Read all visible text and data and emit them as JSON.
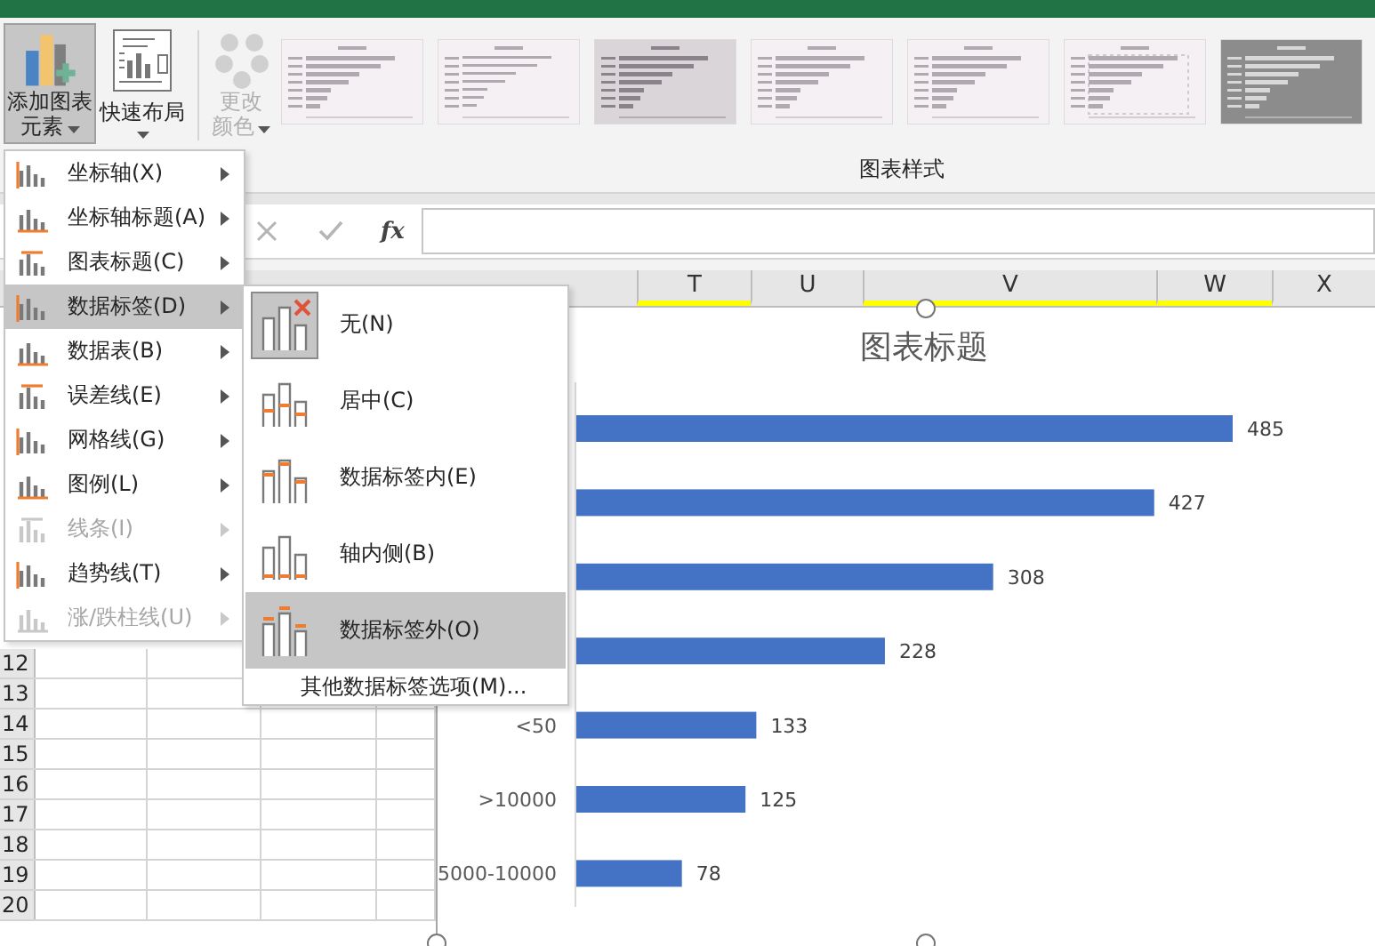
{
  "ribbon": {
    "buttons": [
      {
        "kind": "elements",
        "lines": [
          "添加图表",
          "元素"
        ],
        "selected": true,
        "disabled": false
      },
      {
        "kind": "layout",
        "lines": [
          "快速布局"
        ],
        "selected": false,
        "disabled": false
      },
      {
        "kind": "colors",
        "lines": [
          "更改",
          "颜色"
        ],
        "selected": false,
        "disabled": true
      }
    ],
    "styles": [
      {
        "kind": "plain"
      },
      {
        "kind": "dotted"
      },
      {
        "kind": "shaded"
      },
      {
        "kind": "plain"
      },
      {
        "kind": "plain"
      },
      {
        "kind": "hatched"
      },
      {
        "kind": "dark"
      }
    ],
    "group_label": "图表样式"
  },
  "formula_bar": {
    "fx": "fx"
  },
  "columns": [
    {
      "label": "T",
      "highlighted": true
    },
    {
      "label": "U",
      "highlighted": false
    },
    {
      "label": "V",
      "highlighted": true
    },
    {
      "label": "W",
      "highlighted": true
    },
    {
      "label": "X",
      "highlighted": false
    }
  ],
  "rows": [
    "12",
    "13",
    "14",
    "15",
    "16",
    "17",
    "18",
    "19",
    "20"
  ],
  "chart": {
    "title": "图表标题",
    "chart_data": {
      "type": "bar",
      "orientation": "horizontal",
      "categories": [
        null,
        null,
        null,
        null,
        "<50",
        ">10000",
        "5000-10000"
      ],
      "values": [
        485,
        427,
        308,
        228,
        133,
        125,
        78
      ],
      "data_labels": true
    }
  },
  "menu": {
    "items": [
      {
        "label": "坐标轴(X)",
        "disabled": false,
        "highlighted": false
      },
      {
        "label": "坐标轴标题(A)",
        "disabled": false,
        "highlighted": false
      },
      {
        "label": "图表标题(C)",
        "disabled": false,
        "highlighted": false
      },
      {
        "label": "数据标签(D)",
        "disabled": false,
        "highlighted": true
      },
      {
        "label": "数据表(B)",
        "disabled": false,
        "highlighted": false
      },
      {
        "label": "误差线(E)",
        "disabled": false,
        "highlighted": false
      },
      {
        "label": "网格线(G)",
        "disabled": false,
        "highlighted": false
      },
      {
        "label": "图例(L)",
        "disabled": false,
        "highlighted": false
      },
      {
        "label": "线条(I)",
        "disabled": true,
        "highlighted": false
      },
      {
        "label": "趋势线(T)",
        "disabled": false,
        "highlighted": false
      },
      {
        "label": "涨/跌柱线(U)",
        "disabled": true,
        "highlighted": false
      }
    ]
  },
  "submenu": {
    "items": [
      {
        "label": "无(N)",
        "kind": "none",
        "selected": true,
        "highlighted": false
      },
      {
        "label": "居中(C)",
        "kind": "center",
        "selected": false,
        "highlighted": false
      },
      {
        "label": "数据标签内(E)",
        "kind": "inside",
        "selected": false,
        "highlighted": false
      },
      {
        "label": "轴内侧(B)",
        "kind": "base",
        "selected": false,
        "highlighted": false
      },
      {
        "label": "数据标签外(O)",
        "kind": "outside",
        "selected": false,
        "highlighted": true
      }
    ],
    "more": "其他数据标签选项(M)..."
  }
}
